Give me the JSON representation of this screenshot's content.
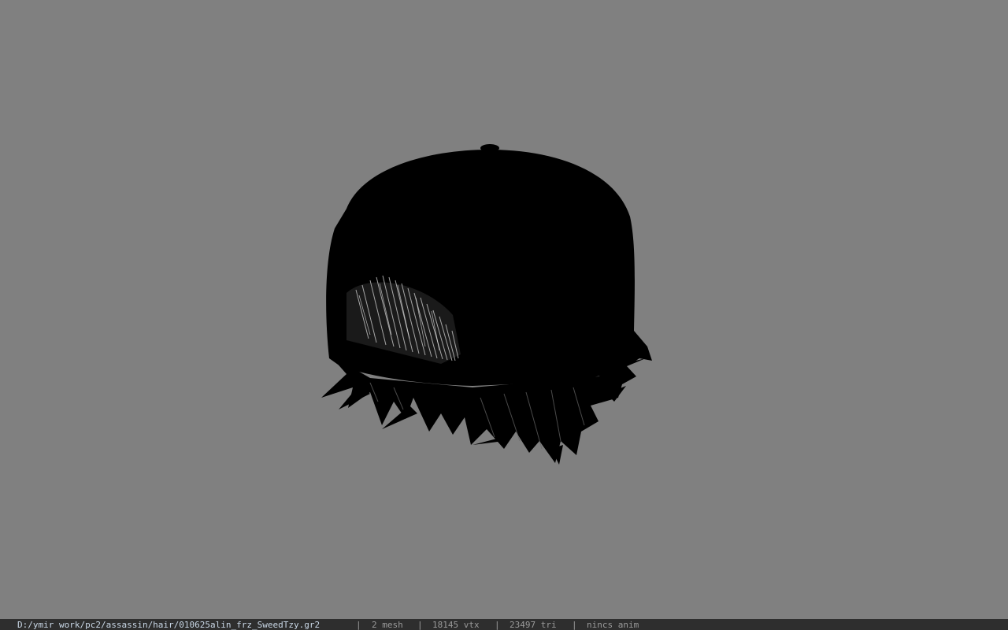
{
  "viewer": {
    "background_color": "#808080",
    "model_color": "#000000",
    "highlight_color": "#bfbfbf"
  },
  "status": {
    "file_path": "D:/ymir work/pc2/assassin/hair/010625alin_frz_SweedTzy.gr2",
    "separator": "|",
    "mesh_count": "2 mesh",
    "vertex_count": "18145 vtx",
    "triangle_count": "23497 tri",
    "anim_state": "nincs anim"
  },
  "icons": {
    "model": "hair-cap-model"
  }
}
